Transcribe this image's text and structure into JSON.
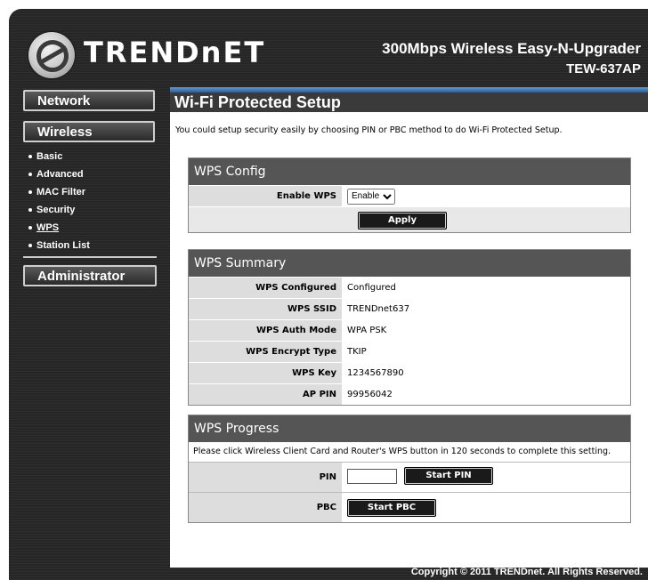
{
  "header": {
    "logo_text": "TRENDnET",
    "product_title": "300Mbps Wireless Easy-N-Upgrader",
    "product_model": "TEW-637AP"
  },
  "sidebar": {
    "network": "Network",
    "wireless": "Wireless",
    "wireless_items": [
      {
        "label": "Basic"
      },
      {
        "label": "Advanced"
      },
      {
        "label": "MAC Filter"
      },
      {
        "label": "Security"
      },
      {
        "label": "WPS",
        "active": true
      },
      {
        "label": "Station List"
      }
    ],
    "administrator": "Administrator"
  },
  "page": {
    "title": "Wi-Fi Protected Setup",
    "description": "You could setup security easily by choosing PIN or PBC method to do Wi-Fi Protected Setup."
  },
  "wps_config": {
    "title": "WPS Config",
    "enable_label": "Enable WPS",
    "enable_value": "Enable",
    "apply_label": "Apply"
  },
  "wps_summary": {
    "title": "WPS Summary",
    "rows": [
      {
        "label": "WPS Configured",
        "value": "Configured"
      },
      {
        "label": "WPS SSID",
        "value": "TRENDnet637"
      },
      {
        "label": "WPS Auth Mode",
        "value": "WPA PSK"
      },
      {
        "label": "WPS Encrypt Type",
        "value": "TKIP"
      },
      {
        "label": "WPS Key",
        "value": "1234567890"
      },
      {
        "label": "AP PIN",
        "value": "99956042"
      }
    ]
  },
  "wps_progress": {
    "title": "WPS Progress",
    "instruction": "Please click Wireless Client Card and Router's WPS button in 120 seconds to complete this setting.",
    "pin_label": "PIN",
    "pin_value": "",
    "start_pin_label": "Start PIN",
    "pbc_label": "PBC",
    "start_pbc_label": "Start PBC"
  },
  "footer": {
    "copyright": "Copyright © 2011 TRENDnet. All Rights Reserved."
  }
}
